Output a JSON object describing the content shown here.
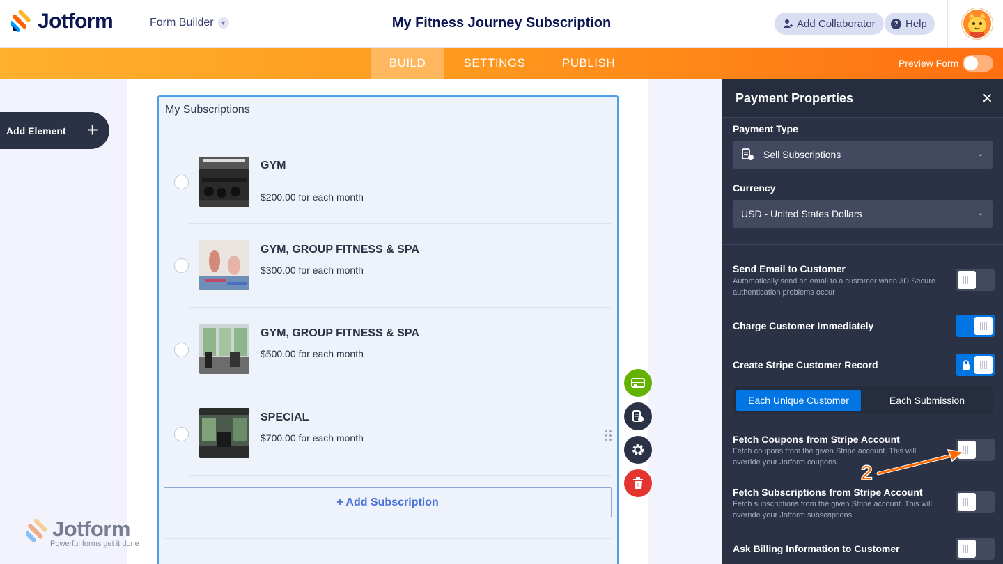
{
  "header": {
    "logo_text": "Jotform",
    "product_menu": "Form Builder",
    "title": "My Fitness Journey Subscription",
    "add_collaborator": "Add Collaborator",
    "help": "Help"
  },
  "nav": {
    "tabs": [
      "BUILD",
      "SETTINGS",
      "PUBLISH"
    ],
    "active_tab": "BUILD",
    "preview_label": "Preview Form"
  },
  "sidebar": {
    "add_element": "Add Element"
  },
  "form": {
    "block_title": "My Subscriptions",
    "items": [
      {
        "name": "GYM",
        "price": "$200.00 for each month"
      },
      {
        "name": "GYM, GROUP FITNESS & SPA",
        "price": "$300.00 for each month"
      },
      {
        "name": "GYM, GROUP FITNESS & SPA",
        "price": "$500.00 for each month"
      },
      {
        "name": "SPECIAL",
        "price": "$700.00 for each month"
      }
    ],
    "add_subscription": "+ Add Subscription"
  },
  "watermark": {
    "text": "Jotform",
    "tagline": "Powerful forms get it done"
  },
  "panel": {
    "title": "Payment Properties",
    "payment_type_label": "Payment Type",
    "payment_type_value": "Sell Subscriptions",
    "currency_label": "Currency",
    "currency_value": "USD - United States Dollars",
    "send_email": {
      "label": "Send Email to Customer",
      "desc": "Automatically send an email to a customer when 3D Secure authentication problems occur",
      "on": false
    },
    "charge_immediately": {
      "label": "Charge Customer Immediately",
      "on": true
    },
    "create_record": {
      "label": "Create Stripe Customer Record",
      "on": true,
      "locked": true
    },
    "record_options": [
      "Each Unique Customer",
      "Each Submission"
    ],
    "record_selected": "Each Unique Customer",
    "fetch_coupons": {
      "label": "Fetch Coupons from Stripe Account",
      "desc": "Fetch coupons from the given Stripe account. This will override your Jotform coupons.",
      "on": false
    },
    "fetch_subscriptions": {
      "label": "Fetch Subscriptions from Stripe Account",
      "desc": "Fetch subscriptions from the given Stripe account. This will override your Jotform subscriptions.",
      "on": false
    },
    "billing_info": {
      "label": "Ask Billing Information to Customer",
      "on": false
    }
  },
  "annotation": {
    "step": "2"
  },
  "colors": {
    "accent": "#ff6f10",
    "toggle_on": "#0075e3",
    "panel_bg": "#2b3245"
  }
}
